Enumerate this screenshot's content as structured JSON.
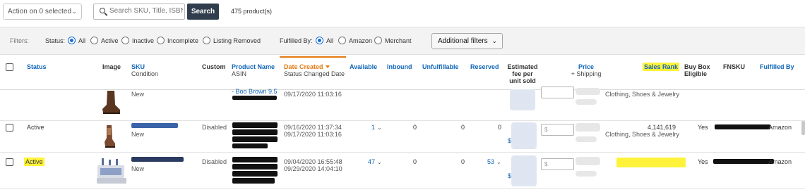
{
  "toolbar": {
    "action_label": "Action on 0 selected",
    "search_placeholder": "Search SKU, Title, ISBN,",
    "search_button": "Search",
    "product_count": "475 product(s)"
  },
  "filters": {
    "label": "Filters:",
    "status_label": "Status:",
    "status_options": [
      "All",
      "Active",
      "Inactive",
      "Incomplete",
      "Listing Removed"
    ],
    "status_selected": "All",
    "fulfilled_label": "Fulfilled By:",
    "fulfilled_options": [
      "All",
      "Amazon",
      "Merchant"
    ],
    "fulfilled_selected": "All",
    "additional_label": "Additional filters"
  },
  "columns": {
    "status": "Status",
    "image": "Image",
    "sku": "SKU",
    "sku_sub": "Condition",
    "custom": "Custom",
    "product_name": "Product Name",
    "product_name_sub": "ASIN",
    "date_created": "Date Created",
    "date_created_sub": "Status Changed Date",
    "available": "Available",
    "inbound": "Inbound",
    "unfulfillable": "Unfulfillable",
    "reserved": "Reserved",
    "estimated_fee_1": "Estimated",
    "estimated_fee_2": "fee per",
    "estimated_fee_3": "unit sold",
    "price": "Price",
    "price_sub": "+ Shipping",
    "sales_rank": "Sales Rank",
    "buy_box_1": "Buy Box",
    "buy_box_2": "Eligible",
    "fnsku": "FNSKU",
    "fulfilled_by": "Fulfilled By"
  },
  "rows": [
    {
      "condition": "New",
      "product_name": "- Boo Brown 9.5",
      "date_created": "09/17/2020 11:03:16",
      "category": "Clothing, Shoes & Jewelry"
    },
    {
      "status": "Active",
      "custom": "Disabled",
      "condition": "New",
      "date_created": "09/16/2020 11:37:34",
      "status_changed": "09/17/2020 11:03:16",
      "available": "1",
      "inbound": "0",
      "unfulfillable": "0",
      "reserved": "0",
      "price_placeholder": "$",
      "fee_symbol": "$",
      "sales_rank": "4,141,619",
      "category": "Clothing, Shoes & Jewelry",
      "buy_box": "Yes",
      "fulfilled_by": "Amazon"
    },
    {
      "status": "Active",
      "custom": "Disabled",
      "condition": "New",
      "date_created": "09/04/2020 16:55:48",
      "status_changed": "09/29/2020 14:04:10",
      "available": "47",
      "inbound": "0",
      "unfulfillable": "0",
      "reserved": "53",
      "price_placeholder": "$",
      "fee_symbol": "$",
      "buy_box": "Yes",
      "fulfilled_by": "Amazon"
    }
  ],
  "colors": {
    "accent_blue": "#1066b8",
    "sort_orange": "#e47911",
    "highlight_yellow": "#fff23a",
    "search_button_bg": "#2f3d4c"
  }
}
